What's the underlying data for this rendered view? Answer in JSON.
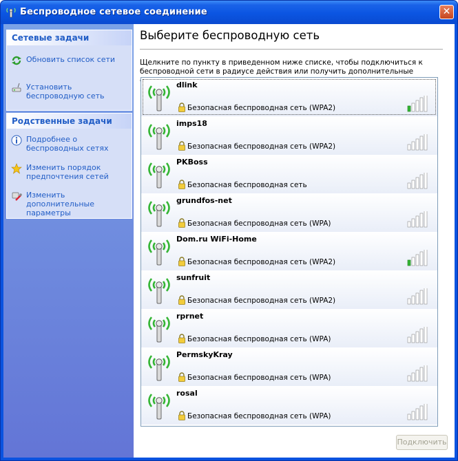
{
  "window": {
    "title": "Беспроводное сетевое соединение",
    "close_glyph": "✕"
  },
  "sidebar": {
    "network_tasks": {
      "header": "Сетевые задачи",
      "items": [
        {
          "label": "Обновить список сети",
          "icon": "refresh-icon"
        },
        {
          "label": "Установить беспроводную сеть",
          "icon": "setup-network-icon"
        }
      ]
    },
    "related_tasks": {
      "header": "Родственные задачи",
      "items": [
        {
          "label": "Подробнее о беспроводных сетях",
          "icon": "info-icon"
        },
        {
          "label": "Изменить порядок предпочтения сетей",
          "icon": "star-icon"
        },
        {
          "label": "Изменить дополнительные параметры",
          "icon": "settings-icon"
        }
      ]
    }
  },
  "main": {
    "heading": "Выберите беспроводную сеть",
    "description": "Щелкните по пункту в приведенном ниже списке, чтобы подключиться к беспроводной сети в радиусе действия или получить дополнительные сведения.",
    "connect_button": "Подключить",
    "networks": [
      {
        "name": "dlink",
        "security": "Безопасная беспроводная сеть (WPA2)",
        "signal": 1
      },
      {
        "name": "imps18",
        "security": "Безопасная беспроводная сеть (WPA2)",
        "signal": 0
      },
      {
        "name": "PKBoss",
        "security": "Безопасная беспроводная сеть",
        "signal": 0
      },
      {
        "name": "grundfos-net",
        "security": "Безопасная беспроводная сеть (WPA)",
        "signal": 0
      },
      {
        "name": "Dom.ru WiFi-Home",
        "security": "Безопасная беспроводная сеть (WPA2)",
        "signal": 1
      },
      {
        "name": "sunfruit",
        "security": "Безопасная беспроводная сеть (WPA2)",
        "signal": 0
      },
      {
        "name": "rprnet",
        "security": "Безопасная беспроводная сеть (WPA)",
        "signal": 0
      },
      {
        "name": "PermskyKray",
        "security": "Безопасная беспроводная сеть (WPA)",
        "signal": 0
      },
      {
        "name": "rosal",
        "security": "Безопасная беспроводная сеть (WPA)",
        "signal": 0
      }
    ]
  },
  "colors": {
    "title_bar": "#0b55e2",
    "link_text": "#215dc6",
    "signal_active": "#33b533",
    "signal_inactive": "#c8c8c8"
  }
}
